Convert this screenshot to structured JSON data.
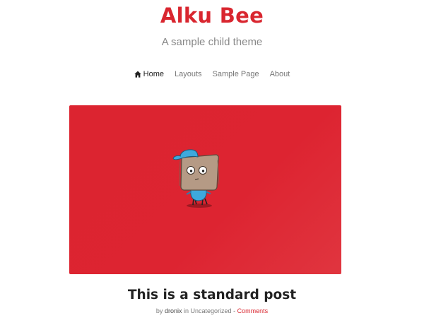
{
  "site": {
    "title": "Alku Bee",
    "description": "A sample child theme",
    "accent_color": "#d9262f"
  },
  "nav": {
    "items": [
      {
        "label": "Home",
        "icon": "home-icon",
        "active": true
      },
      {
        "label": "Layouts",
        "active": false
      },
      {
        "label": "Sample Page",
        "active": false
      },
      {
        "label": "About",
        "active": false
      }
    ]
  },
  "post": {
    "featured_image": {
      "background_color": "#dd2431",
      "subject": "cartoon-bee-mascot"
    },
    "title": "This is a standard post",
    "meta": {
      "by_text": "by",
      "author": "dronix",
      "in_text": "in",
      "category": "Uncategorized",
      "separator": "-",
      "comments_label": "Comments"
    }
  }
}
